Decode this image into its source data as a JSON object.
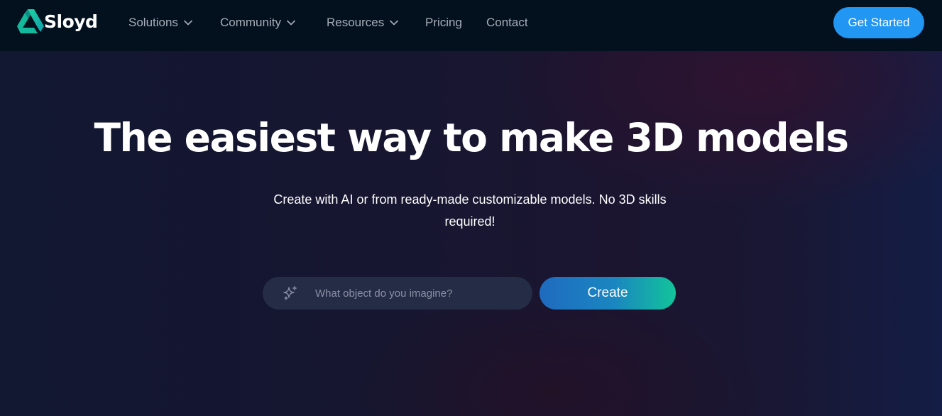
{
  "brand": {
    "name": "Sloyd",
    "logo_icon": "sloyd-logo-icon"
  },
  "nav": {
    "items": [
      {
        "label": "Solutions",
        "has_dropdown": true
      },
      {
        "label": "Community",
        "has_dropdown": true
      },
      {
        "label": "Resources",
        "has_dropdown": true
      },
      {
        "label": "Pricing",
        "has_dropdown": false
      },
      {
        "label": "Contact",
        "has_dropdown": false
      }
    ],
    "cta_label": "Get Started"
  },
  "hero": {
    "headline": "The easiest way to make 3D models",
    "subtitle": "Create with AI or from ready-made customizable models. No 3D skills required!",
    "search": {
      "placeholder": "What object do you imagine?",
      "value": "",
      "icon": "sparkle-icon"
    },
    "create_label": "Create"
  },
  "colors": {
    "nav_bg": "#03111f",
    "hero_bg": "#141731",
    "accent_blue": "#2196f3",
    "create_gradient_start": "#1f6bbf",
    "create_gradient_end": "#12c49a",
    "logo_green": "#17c39a"
  }
}
